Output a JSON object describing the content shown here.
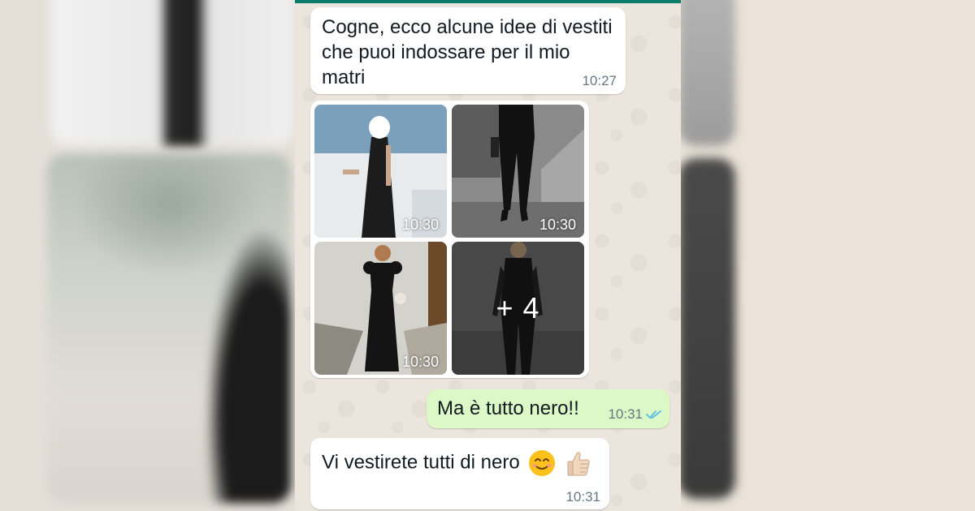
{
  "messages": {
    "m1": {
      "text": "Cogne, ecco alcune idee di vestiti che puoi indossare per il mio matri",
      "time": "10:27"
    },
    "media": {
      "tiles": [
        {
          "time": "10:30",
          "desc": "black-dress-photo"
        },
        {
          "time": "10:30",
          "desc": "black-trousers-photo"
        },
        {
          "time": "10:30",
          "desc": "black-long-dress-photo"
        },
        {
          "more": "+ 4",
          "desc": "black-jumpsuit-photo"
        }
      ]
    },
    "m3": {
      "text": "Ma è tutto nero!!",
      "time": "10:31",
      "status": "read"
    },
    "m4": {
      "text": "Vi vestirete tutti di nero",
      "time": "10:31",
      "emojis": [
        "smiling-face-icon",
        "thumbs-up-icon"
      ]
    }
  },
  "colors": {
    "header_accent": "#0b7d6a",
    "incoming_bubble": "#ffffff",
    "outgoing_bubble": "#dcf8c6",
    "read_ticks": "#53bdeb"
  }
}
